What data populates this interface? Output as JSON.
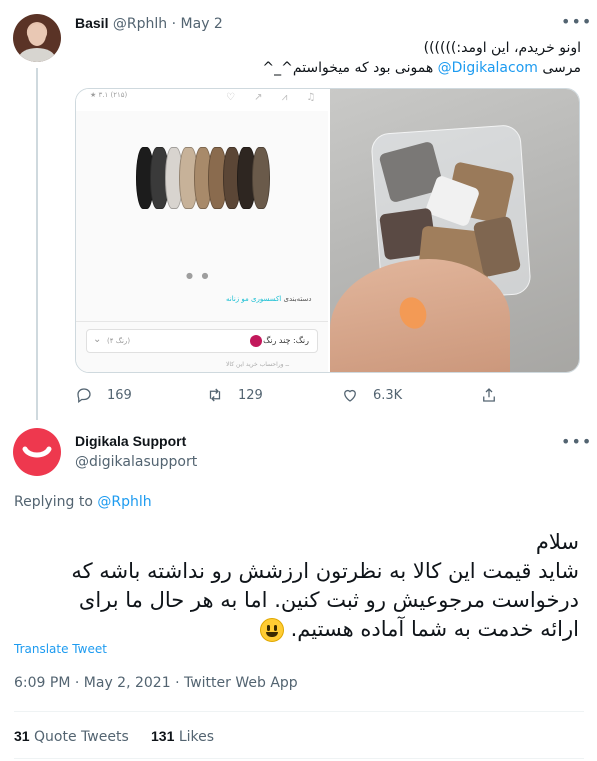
{
  "tweet1": {
    "display_name": "Basil",
    "handle": "@Rphlh",
    "separator": "·",
    "date": "May 2",
    "more_icon": "more-horizontal-icon",
    "line1": "اونو خریدم، این اومد:))))))",
    "line2_prefix": "مرسی ",
    "mention": "@Digikalacom",
    "line2_suffix": " همونی بود که میخواستم^_^",
    "media": {
      "screenshot": {
        "rating": "★ ۳.۱ (۲۱۵)",
        "category_prefix": "دسته‌بندی ",
        "category_link": "اکسسوری مو زنانه",
        "color_label": "رنگ: ",
        "color_value": "چند رنگ",
        "color_count": "(۴ رنگ)",
        "footer": "ــ وراحساب خرید این کالا"
      }
    },
    "actions": {
      "replies": "169",
      "retweets": "129",
      "likes": "6.3K"
    }
  },
  "tweet2": {
    "display_name": "Digikala Support",
    "handle": "@digikalasupport",
    "replying_label": "Replying to ",
    "replying_handle": "@Rphlh",
    "text_line1": "سلام",
    "text_line2": "شاید قیمت این کالا به نظرتون ارزشش رو نداشته باشه که",
    "text_line3": "درخواست مرجوعیش رو ثبت کنین. اما به هر حال ما برای",
    "text_line4": "ارائه خدمت به شما آماده هستیم.",
    "translate": "Translate Tweet",
    "time": "6:09 PM",
    "date": "May 2, 2021",
    "source": "Twitter Web App",
    "quote_tweets_count": "31",
    "quote_tweets_label": "Quote Tweets",
    "likes_count": "131",
    "likes_label": "Likes"
  },
  "colors": {
    "accent": "#1d9bf0",
    "text": "#0f1419",
    "muted": "#536471",
    "border": "#cfd9de",
    "digikala_red": "#ee384e",
    "band_colors": [
      "#1c1c1c",
      "#3a3a3a",
      "#d8d4cf",
      "#c7b299",
      "#a88a6a",
      "#8a6b4e",
      "#5b4636",
      "#2e2621",
      "#6a5a4a"
    ]
  }
}
